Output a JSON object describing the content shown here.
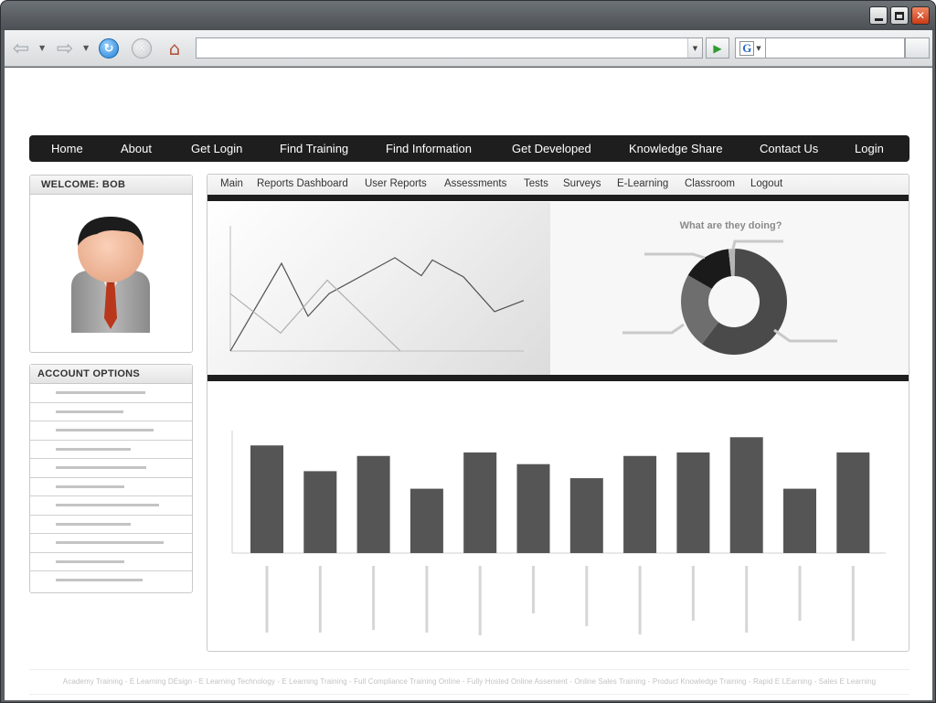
{
  "browser": {
    "url": "",
    "search_value": "",
    "search_engine_glyph": "G",
    "icons": [
      "back-arrow-icon",
      "forward-arrow-icon",
      "refresh-icon",
      "stop-icon",
      "home-icon",
      "go-arrow-icon"
    ]
  },
  "nav": {
    "items": [
      "Home",
      "About",
      "Get Login",
      "Find Training",
      "Find Information",
      "Get Developed",
      "Knowledge Share",
      "Contact Us",
      "Login"
    ]
  },
  "welcome": {
    "title": "WELCOME: BOB"
  },
  "account": {
    "title": "ACCOUNT OPTIONS",
    "item_count": 11
  },
  "subnav": {
    "items": [
      "Main",
      "Reports Dashboard",
      "User Reports",
      "Assessments",
      "Tests",
      "Surveys",
      "E-Learning",
      "Classroom",
      "Logout"
    ]
  },
  "donut": {
    "title": "What are they doing?"
  },
  "chart_data": [
    {
      "type": "line",
      "title": "",
      "x": [
        0,
        1,
        2,
        3,
        4,
        5,
        6,
        7,
        8,
        9
      ],
      "series": [
        {
          "values": [
            0,
            0.78,
            0.31,
            0.51,
            0.83,
            0.67,
            0.81,
            0.66,
            0.35,
            0.45
          ]
        },
        {
          "values": [
            0.51,
            0.16,
            0.63,
            0.0
          ]
        }
      ],
      "grid": false
    },
    {
      "type": "pie",
      "donut": true,
      "title": "What are they doing?",
      "values": [
        60,
        23,
        15,
        2
      ],
      "colors": [
        "#4a4a4a",
        "#6e6e6e",
        "#1a1a1a",
        "#b5b5b5"
      ]
    },
    {
      "type": "bar",
      "title": "",
      "values": [
        92,
        70,
        83,
        55,
        86,
        76,
        64,
        83,
        86,
        99,
        55,
        86
      ],
      "ylim": [
        0,
        100
      ],
      "colors": [
        "#555555"
      ],
      "grid": false
    }
  ],
  "footer": {
    "text": "Academy Training - E Learning DEsign - E Learning Technology - E Learning Training - Full Compliance Training Online - Fully Hosted Online Assement - Online Sales Training - Product Knowledge Training - Rapid E LEarning - Sales E Learning"
  }
}
